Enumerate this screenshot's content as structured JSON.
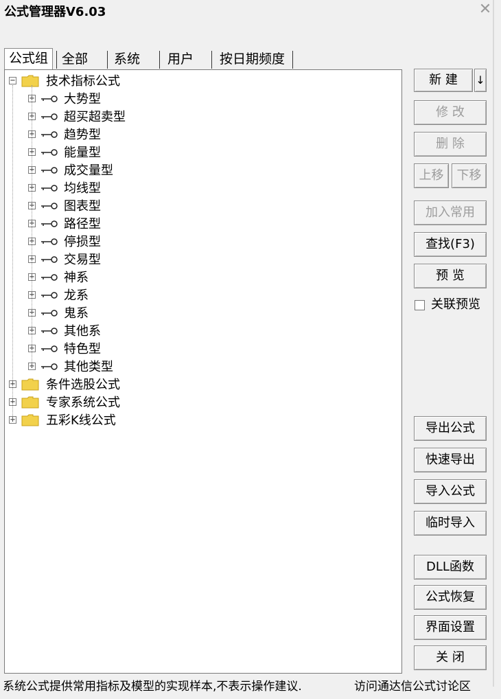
{
  "window": {
    "title": "公式管理器V6.03",
    "close_icon": "close-icon"
  },
  "tabs": [
    {
      "label": "公式组",
      "active": true
    },
    {
      "label": "全部"
    },
    {
      "label": "系统"
    },
    {
      "label": "用户"
    },
    {
      "label": "按日期频度"
    }
  ],
  "tree": {
    "groups": [
      {
        "label": "技术指标公式",
        "expanded": true,
        "children": [
          "大势型",
          "超买超卖型",
          "趋势型",
          "能量型",
          "成交量型",
          "均线型",
          "图表型",
          "路径型",
          "停损型",
          "交易型",
          "神系",
          "龙系",
          "鬼系",
          "其他系",
          "特色型",
          "其他类型"
        ]
      },
      {
        "label": "条件选股公式",
        "expanded": false
      },
      {
        "label": "专家系统公式",
        "expanded": false
      },
      {
        "label": "五彩K线公式",
        "expanded": false
      }
    ]
  },
  "buttons": {
    "new": "新  建",
    "new_dropdown": "↓",
    "modify": "修  改",
    "delete": "删  除",
    "move_up": "上移",
    "move_down": "下移",
    "add_common": "加入常用",
    "find": "查找(F3)",
    "preview": "预  览",
    "export": "导出公式",
    "quick_export": "快速导出",
    "import": "导入公式",
    "temp_import": "临时导入",
    "dll": "DLL函数",
    "restore": "公式恢复",
    "ui_settings": "界面设置",
    "close": "关  闭"
  },
  "checkbox": {
    "label": "关联预览",
    "checked": false
  },
  "status": {
    "left": "系统公式提供常用指标及模型的实现样本,不表示操作建议.",
    "right": "访问通达信公式讨论区"
  },
  "colors": {
    "folder": "#f2d14b",
    "folder_dark": "#c9a21a",
    "disabled_text": "#9c9c9c"
  }
}
